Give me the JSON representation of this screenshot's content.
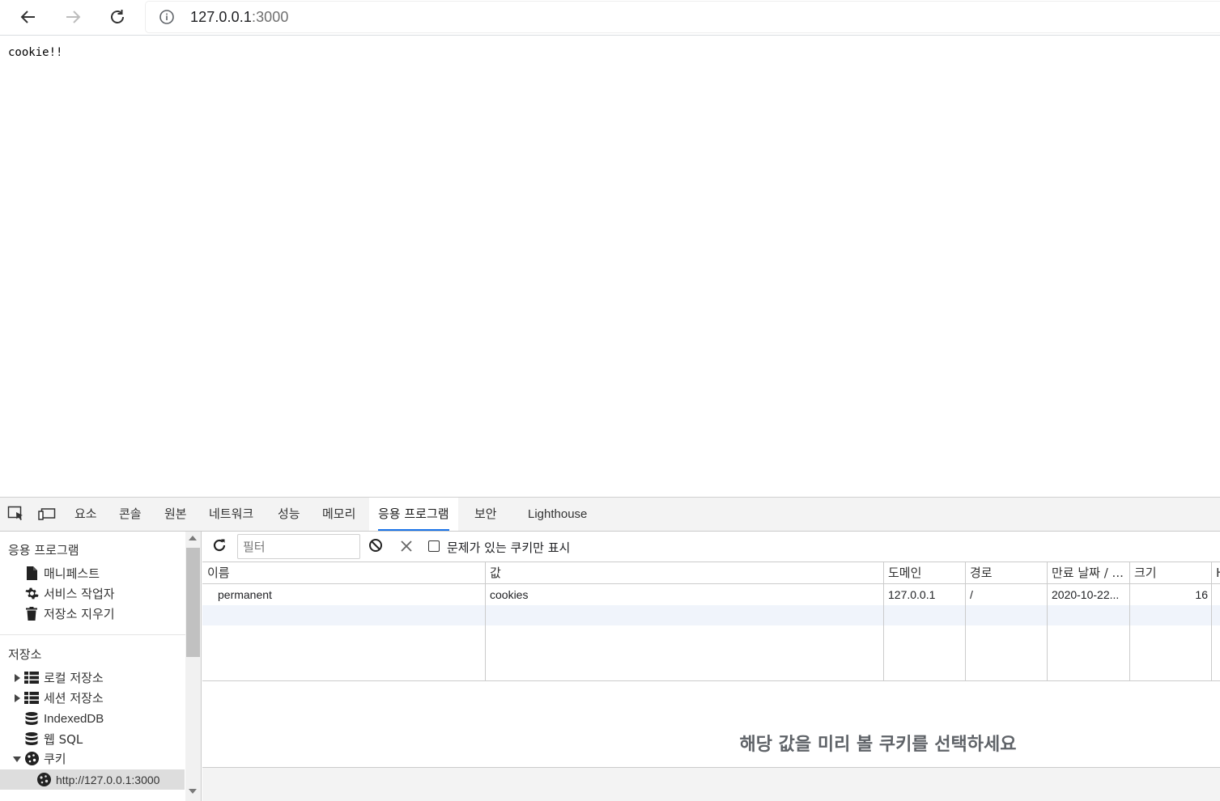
{
  "browser": {
    "url_host": "127.0.0.1",
    "url_port": ":3000",
    "back_icon": "arrow-left-icon",
    "forward_icon": "arrow-right-icon",
    "reload_icon": "reload-icon",
    "info_icon": "info-icon"
  },
  "page": {
    "text": "cookie!!"
  },
  "devtools": {
    "tabs": [
      {
        "label": "요소"
      },
      {
        "label": "콘솔"
      },
      {
        "label": "원본"
      },
      {
        "label": "네트워크"
      },
      {
        "label": "성능"
      },
      {
        "label": "메모리"
      },
      {
        "label": "응용 프로그램",
        "active": true
      },
      {
        "label": "보안"
      },
      {
        "label": "Lighthouse"
      }
    ],
    "accent": "#1a73e8",
    "sidebar": {
      "section_app": "응용 프로그램",
      "app_items": [
        {
          "label": "매니페스트",
          "icon": "file-icon"
        },
        {
          "label": "서비스 작업자",
          "icon": "gear-icon"
        },
        {
          "label": "저장소 지우기",
          "icon": "trash-icon"
        }
      ],
      "section_storage": "저장소",
      "storage_items": [
        {
          "label": "로컬 저장소",
          "icon": "grid-icon"
        },
        {
          "label": "세션 저장소",
          "icon": "grid-icon"
        },
        {
          "label": "IndexedDB",
          "icon": "database-icon"
        },
        {
          "label": "웹 SQL",
          "icon": "database-icon"
        },
        {
          "label": "쿠키",
          "icon": "cookie-icon"
        },
        {
          "label": "http://127.0.0.1:3000",
          "icon": "cookie-icon"
        }
      ]
    },
    "cookies": {
      "filter_placeholder": "필터",
      "issues_only_label": "문제가 있는 쿠키만 표시",
      "issues_only_checked": false,
      "columns": [
        "이름",
        "값",
        "도메인",
        "경로",
        "만료 날짜 / ...",
        "크기",
        "H"
      ],
      "rows": [
        {
          "name": "permanent",
          "value": "cookies",
          "domain": "127.0.0.1",
          "path": "/",
          "expires": "2020-10-22...",
          "size": "16"
        }
      ],
      "preview_message": "해당 값을 미리 볼 쿠키를 선택하세요"
    }
  }
}
